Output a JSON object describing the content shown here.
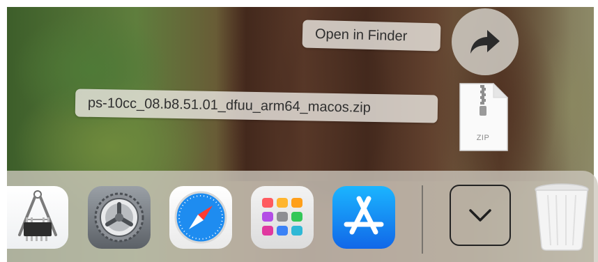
{
  "desktop": {
    "actions": {
      "open_in_finder_label": "Open in Finder"
    },
    "download": {
      "filename": "ps-10cc_08.b8.51.01_dfuu_arm64_macos.zip",
      "file_type_badge": "ZIP",
      "file_icon": "zip-file-icon",
      "open_icon": "share-arrow-icon"
    }
  },
  "dock": {
    "apps": [
      {
        "name": "caliper-chip-app",
        "icon": "caliper-chip-icon"
      },
      {
        "name": "system-settings",
        "icon": "gear-icon"
      },
      {
        "name": "safari",
        "icon": "compass-icon"
      },
      {
        "name": "launchpad",
        "icon": "app-grid-icon"
      },
      {
        "name": "app-store",
        "icon": "app-store-icon"
      }
    ],
    "downloads_stack_icon": "chevron-down-icon",
    "trash_icon": "trash-icon"
  },
  "colors": {
    "label_bg": "#e8e4de",
    "label_text": "#2f2f2f",
    "app_store_blue": "#1a8cff",
    "safari_blue": "#1e8cf0"
  }
}
